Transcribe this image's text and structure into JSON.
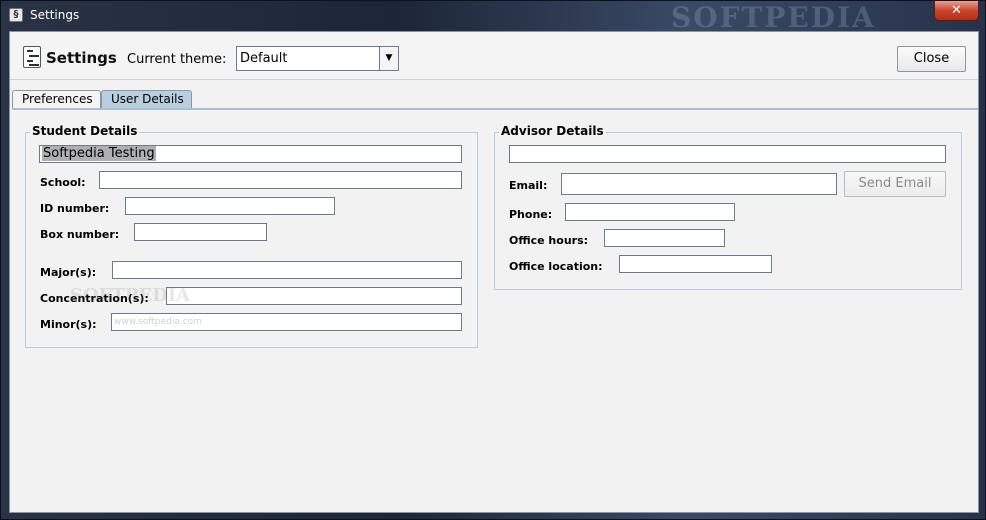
{
  "window": {
    "title": "Settings",
    "watermark": "SOFTPEDIA",
    "close_glyph": "✕"
  },
  "header": {
    "title": "Settings",
    "theme_label": "Current theme:",
    "theme_value": "Default",
    "close_label": "Close"
  },
  "tabs": [
    {
      "label": "Preferences",
      "active": false
    },
    {
      "label": "User Details",
      "active": true
    }
  ],
  "student": {
    "title": "Student Details",
    "name_value": "Softpedia Testing",
    "school_label": "School:",
    "school_value": "",
    "id_label": "ID number:",
    "id_value": "",
    "box_label": "Box number:",
    "box_value": "",
    "major_label": "Major(s):",
    "major_value": "",
    "concentration_label": "Concentration(s):",
    "concentration_value": "",
    "minor_label": "Minor(s):",
    "minor_value": ""
  },
  "advisor": {
    "title": "Advisor Details",
    "name_value": "",
    "email_label": "Email:",
    "email_value": "",
    "send_email_label": "Send Email",
    "phone_label": "Phone:",
    "phone_value": "",
    "hours_label": "Office hours:",
    "hours_value": "",
    "location_label": "Office location:",
    "location_value": ""
  },
  "inline_watermark": "SOFTPEDIA",
  "inline_watermark_url": "www.softpedia.com",
  "icons": [
    "settings-app-icon",
    "window-close-icon",
    "dropdown-arrow-icon"
  ]
}
